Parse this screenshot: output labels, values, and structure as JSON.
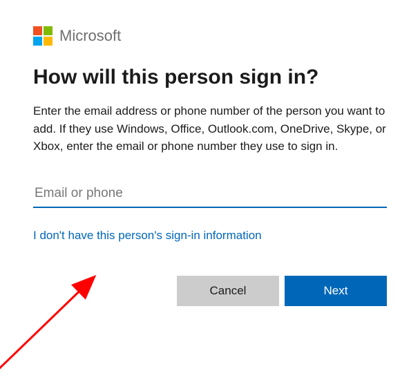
{
  "brand": {
    "name": "Microsoft"
  },
  "heading": "How will this person sign in?",
  "description": "Enter the email address or phone number of the person you want to add. If they use Windows, Office, Outlook.com, OneDrive, Skype, or Xbox, enter the email or phone number they use to sign in.",
  "input": {
    "placeholder": "Email or phone",
    "value": ""
  },
  "no_info_link": "I don't have this person's sign-in information",
  "buttons": {
    "cancel": "Cancel",
    "next": "Next"
  },
  "colors": {
    "accent": "#0067b8",
    "cancel_bg": "#cccccc"
  }
}
